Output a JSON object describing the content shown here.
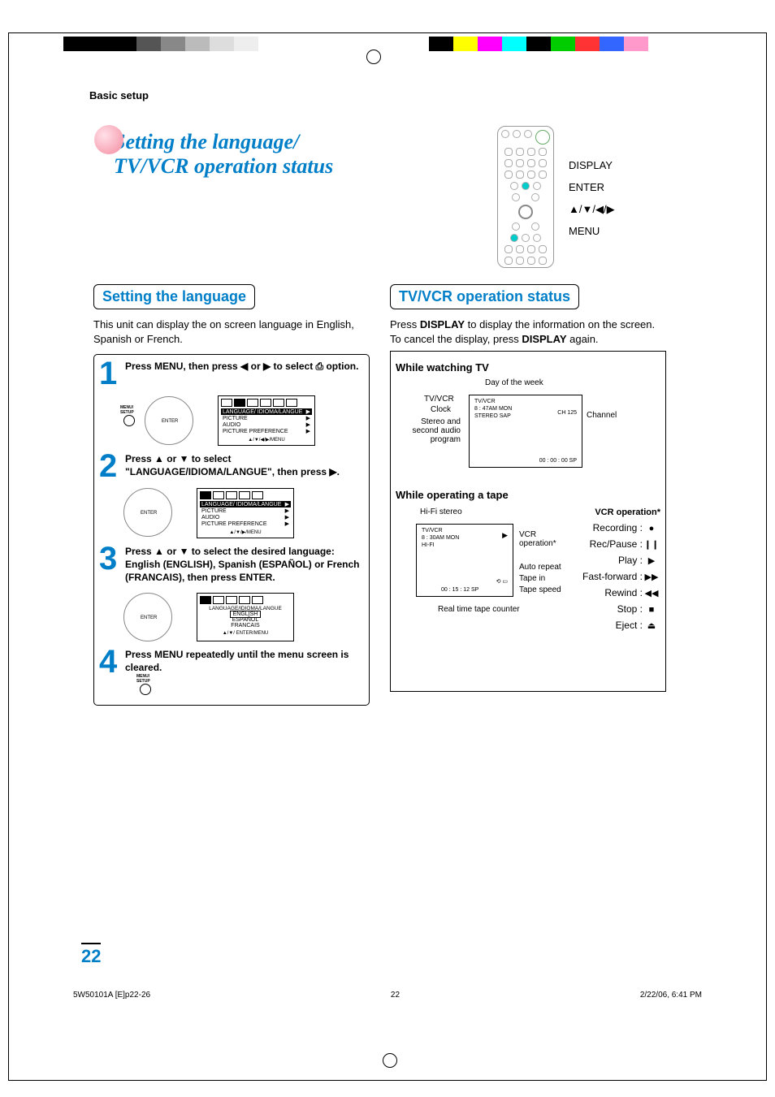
{
  "header_section": "Basic setup",
  "title_line1": "Setting the language/",
  "title_line2": "TV/VCR operation status",
  "remote_labels": [
    "DISPLAY",
    "ENTER",
    "▲/▼/◀/▶",
    "MENU"
  ],
  "left": {
    "section_title": "Setting the language",
    "intro": "This unit can display the on screen language in English, Spanish or French.",
    "step1": "Press MENU, then press ◀ or ▶ to select ⎙ option.",
    "step2": "Press ▲ or ▼ to select \"LANGUAGE/IDIOMA/LANGUE\", then press ▶.",
    "step3": "Press ▲ or ▼ to select the desired language: English (ENGLISH), Spanish (ESPAÑOL) or French (FRANCAIS), then press ENTER.",
    "step4": "Press MENU repeatedly until the menu screen is cleared.",
    "osd_items": [
      "LANGUAGE/\n  IDIOMA/LANGUE",
      "PICTURE",
      "AUDIO",
      "PICTURE PREFERENCE"
    ],
    "osd_foot1": "▲/▼/◀/▶/MENU",
    "osd_foot2": "▲/▼/▶/MENU",
    "osd_lang_title": "LANGUAGE/IDIOMA/LANGUE",
    "osd_langs": [
      "ENGLISH",
      "ESPAÑOL",
      "FRANCAIS"
    ],
    "osd_foot3": "▲/▼/ ENTER/MENU"
  },
  "right": {
    "section_title": "TV/VCR operation status",
    "intro_pre": "Press ",
    "intro_bold1": "DISPLAY",
    "intro_mid": " to display the information on the screen. To cancel the display, press ",
    "intro_bold2": "DISPLAY",
    "intro_post": " again.",
    "tv_heading": "While watching TV",
    "tv_labels": {
      "dayofweek": "Day of the week",
      "tvvcr": "TV/VCR",
      "clock": "Clock",
      "stereo": "Stereo and second audio program",
      "channel": "Channel"
    },
    "tv_inner": {
      "l1": "TV/VCR",
      "l2": "8 : 47AM  MON",
      "l3": "STEREO  SAP",
      "ch": "CH  125",
      "counter": "00 : 00 : 00   SP"
    },
    "tape_heading": "While operating a tape",
    "tape_labels": {
      "hifi": "Hi-Fi stereo",
      "vcrop": "VCR operation*",
      "autorepeat": "Auto repeat",
      "tapein": "Tape in",
      "tapespeed": "Tape speed",
      "counter": "Real time tape counter"
    },
    "tape_inner": {
      "l1": "TV/VCR",
      "l2": "8 : 30AM  MON",
      "l3": "HI-FI",
      "play": "▶",
      "counter": "00 : 15 : 12   SP"
    },
    "ops_title": "VCR operation*",
    "ops": [
      {
        "label": "Recording :",
        "sym": "●"
      },
      {
        "label": "Rec/Pause :",
        "sym": "❙❙"
      },
      {
        "label": "Play :",
        "sym": "▶"
      },
      {
        "label": "Fast-forward :",
        "sym": "▶▶"
      },
      {
        "label": "Rewind :",
        "sym": "◀◀"
      },
      {
        "label": "Stop :",
        "sym": "■"
      },
      {
        "label": "Eject :",
        "sym": "⏏"
      }
    ]
  },
  "page_num": "22",
  "footer": {
    "left": "5W50101A [E]p22-26",
    "mid": "22",
    "right": "2/22/06, 6:41 PM"
  }
}
